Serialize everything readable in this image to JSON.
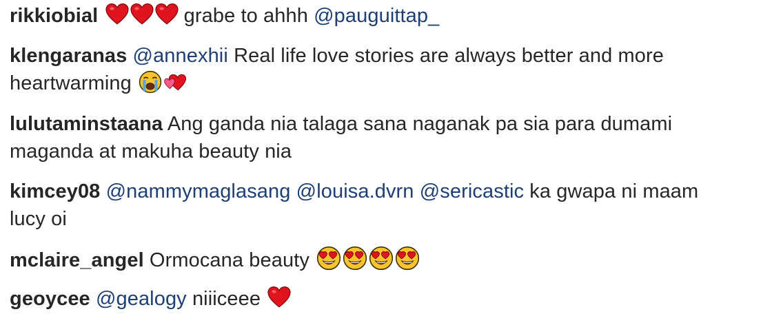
{
  "comments": [
    {
      "username": "rikkiobial",
      "heart_emojis": [
        "red-heart",
        "red-heart",
        "red-heart"
      ],
      "text_after": "grabe to ahhh",
      "mention": "@pauguittap_"
    },
    {
      "username": "klengaranas",
      "mention": "@annexhii",
      "text_line1": "Real life love stories are always better and more",
      "text_line2": "heartwarming",
      "emojis": [
        "loudly-crying-face",
        "revolving-hearts"
      ]
    },
    {
      "username": "lulutaminstaana",
      "text_line1": "Ang ganda nia talaga sana naganak pa sia para dumami",
      "text_line2": "maganda at makuha beauty nia"
    },
    {
      "username": "kimcey08",
      "mentions": [
        "@nammymaglasang",
        "@louisa.dvrn",
        "@sericastic"
      ],
      "text_after": "ka gwapa ni maam",
      "text_line2": "lucy oi"
    },
    {
      "username": "mclaire_angel",
      "text": "Ormocana beauty",
      "emojis": [
        "heart-eyes-face",
        "heart-eyes-face",
        "heart-eyes-face",
        "heart-eyes-face"
      ]
    },
    {
      "username": "geoycee",
      "mention": "@gealogy",
      "text": "niiiceee",
      "emojis": [
        "red-heart"
      ]
    }
  ],
  "colors": {
    "text": "#262626",
    "mention": "#1e3f73",
    "heart": "#e0141e",
    "face": "#f7c52b"
  }
}
